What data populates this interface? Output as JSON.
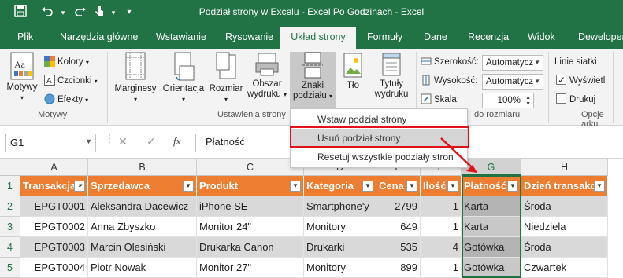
{
  "window": {
    "title": "Podział strony w Excelu - Excel Po Godzinach - Excel"
  },
  "colors": {
    "accent": "#217346",
    "header_fill": "#ed7d31",
    "highlight": "#e3111a"
  },
  "tabs": [
    "Plik",
    "Narzędzia główne",
    "Wstawianie",
    "Rysowanie",
    "Układ strony",
    "Formuły",
    "Dane",
    "Recenzja",
    "Widok",
    "Deweloper"
  ],
  "active_tab": "Układ strony",
  "ribbon": {
    "motywy": {
      "big": "Motywy",
      "colors": "Kolory",
      "fonts": "Czcionki",
      "effects": "Efekty",
      "group": "Motywy"
    },
    "page_setup": {
      "margins": "Marginesy",
      "orientation": "Orientacja",
      "size": "Rozmiar",
      "print_area_1": "Obszar",
      "print_area_2": "wydruku",
      "breaks_1": "Znaki",
      "breaks_2": "podziału",
      "background": "Tło",
      "titles_1": "Tytuły",
      "titles_2": "wydruku",
      "group": "Ustawienia strony"
    },
    "scale": {
      "width_label": "Szerokość:",
      "width_value": "Automatycz",
      "height_label": "Wysokość:",
      "height_value": "Automatycz",
      "scale_label": "Skala:",
      "scale_value": "100%",
      "group": "do rozmiaru"
    },
    "sheet_options": {
      "gridlines": "Linie siatki",
      "view": "Wyświetl",
      "print": "Drukuj",
      "group": "Opcje arku"
    }
  },
  "menu": {
    "items": [
      "Wstaw podział strony",
      "Usuń podział strony",
      "Resetuj wszystkie podziały stron"
    ],
    "selected_index": 1
  },
  "formula_bar": {
    "name_box": "G1",
    "fx": "fx",
    "value": "Płatność"
  },
  "sheet": {
    "columns": [
      "A",
      "B",
      "C",
      "D",
      "E",
      "F",
      "G",
      "H"
    ],
    "selected_column": "G",
    "rows": [
      "1",
      "2",
      "3",
      "4",
      "5"
    ],
    "headers": [
      "Transakcja",
      "Sprzedawca",
      "Produkt",
      "Kategoria",
      "Cena",
      "Ilość",
      "Płatność",
      "Dzień transakcji"
    ],
    "data": [
      [
        "EPGT0001",
        "Aleksandra Dacewicz",
        "iPhone SE",
        "Smartphone'y",
        "2799",
        "1",
        "Karta",
        "Środa"
      ],
      [
        "EPGT0002",
        "Anna Zbyszko",
        "Monitor 24\"",
        "Monitory",
        "649",
        "1",
        "Karta",
        "Niedziela"
      ],
      [
        "EPGT0003",
        "Marcin Olesiński",
        "Drukarka Canon",
        "Drukarki",
        "535",
        "4",
        "Gotówka",
        "Środa"
      ],
      [
        "EPGT0004",
        "Piotr Nowak",
        "Monitor 27\"",
        "Monitory",
        "899",
        "1",
        "Gotówka",
        "Czwartek"
      ]
    ]
  }
}
